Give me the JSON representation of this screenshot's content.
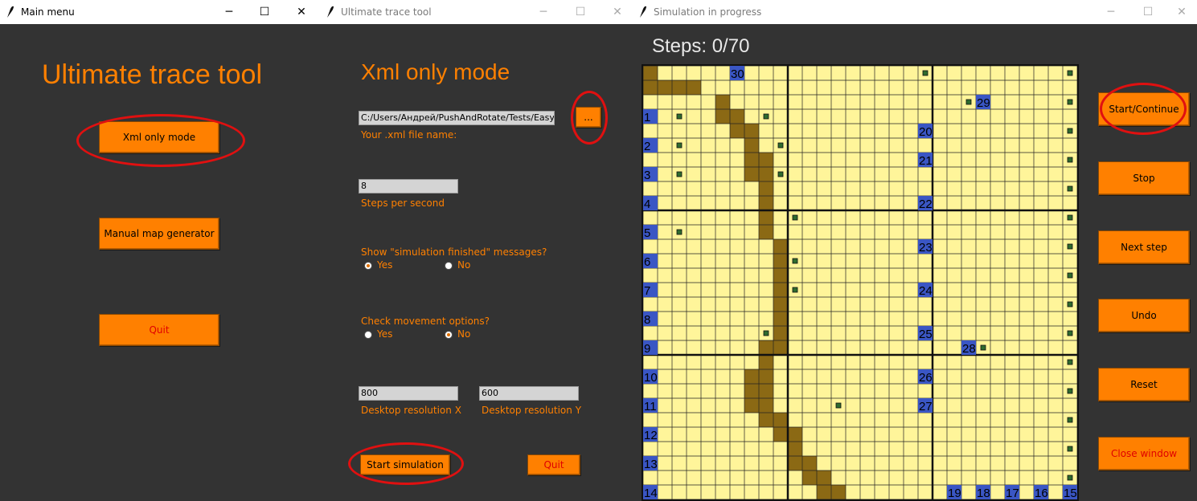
{
  "main_window": {
    "title": "Main menu",
    "heading": "Ultimate trace tool",
    "xml_button": "Xml only mode",
    "manual_button": "Manual map generator",
    "quit_button": "Quit",
    "controls": {
      "minimize": "─",
      "maximize": "☐",
      "close": "✕"
    }
  },
  "tool_window": {
    "title": "Ultimate trace tool",
    "heading": "Xml only mode",
    "file_path": "C:/Users/Андрей/PushAndRotate/Tests/EasyE",
    "browse_button": "...",
    "file_label": "Your .xml file name:",
    "steps_value": "8",
    "steps_label": "Steps per second",
    "show_msg_question": "Show \"simulation finished\" messages?",
    "show_msg_yes": "Yes",
    "show_msg_no": "No",
    "show_msg_selected": "Yes",
    "check_move_question": "Check movement options?",
    "check_move_yes": "Yes",
    "check_move_no": "No",
    "check_move_selected": "No",
    "res_x_value": "800",
    "res_x_label": "Desktop resolution X",
    "res_y_value": "600",
    "res_y_label": "Desktop resolution Y",
    "start_button": "Start simulation",
    "quit_button": "Quit",
    "controls": {
      "minimize": "─",
      "maximize": "☐",
      "close": "✕"
    }
  },
  "sim_window": {
    "title": "Simulation in progress",
    "steps_text": "Steps: 0/70",
    "buttons": {
      "start": "Start/Continue",
      "stop": "Stop",
      "next": "Next step",
      "undo": "Undo",
      "reset": "Reset",
      "close": "Close window"
    },
    "controls": {
      "minimize": "─",
      "maximize": "☐",
      "close": "✕"
    }
  },
  "colors": {
    "accent": "#ff8000",
    "background": "#333333",
    "cell": "#fff59a",
    "obstacle": "#8b6914",
    "agent": "#3a56c4",
    "goal": "#2e6b2e",
    "highlight_oval": "#e01010"
  },
  "grid_map": {
    "rows": 30,
    "cols": 30,
    "obstacles": [
      [
        0,
        0
      ],
      [
        1,
        0
      ],
      [
        1,
        1
      ],
      [
        1,
        2
      ],
      [
        1,
        3
      ],
      [
        2,
        5
      ],
      [
        3,
        5
      ],
      [
        3,
        6
      ],
      [
        4,
        6
      ],
      [
        4,
        7
      ],
      [
        5,
        7
      ],
      [
        6,
        7
      ],
      [
        6,
        8
      ],
      [
        7,
        7
      ],
      [
        7,
        8
      ],
      [
        8,
        8
      ],
      [
        9,
        8
      ],
      [
        10,
        8
      ],
      [
        11,
        8
      ],
      [
        12,
        9
      ],
      [
        13,
        9
      ],
      [
        14,
        9
      ],
      [
        15,
        9
      ],
      [
        16,
        9
      ],
      [
        17,
        9
      ],
      [
        18,
        9
      ],
      [
        19,
        8
      ],
      [
        19,
        9
      ],
      [
        20,
        8
      ],
      [
        21,
        7
      ],
      [
        21,
        8
      ],
      [
        22,
        7
      ],
      [
        22,
        8
      ],
      [
        23,
        7
      ],
      [
        23,
        8
      ],
      [
        24,
        8
      ],
      [
        24,
        9
      ],
      [
        25,
        9
      ],
      [
        25,
        10
      ],
      [
        26,
        10
      ],
      [
        27,
        10
      ],
      [
        27,
        11
      ],
      [
        28,
        11
      ],
      [
        28,
        12
      ],
      [
        29,
        12
      ],
      [
        29,
        13
      ],
      [
        30,
        13
      ],
      [
        30,
        14
      ],
      [
        31,
        14
      ],
      [
        31,
        15
      ],
      [
        32,
        15
      ],
      [
        33,
        15
      ],
      [
        33,
        16
      ]
    ],
    "agents": [
      {
        "label": "30",
        "row": 0,
        "col": 6
      },
      {
        "label": "29",
        "row": 2,
        "col": 23
      },
      {
        "label": "1",
        "row": 3,
        "col": 0
      },
      {
        "label": "20",
        "row": 4,
        "col": 19
      },
      {
        "label": "2",
        "row": 5,
        "col": 0
      },
      {
        "label": "21",
        "row": 6,
        "col": 19
      },
      {
        "label": "3",
        "row": 7,
        "col": 0
      },
      {
        "label": "4",
        "row": 9,
        "col": 0
      },
      {
        "label": "22",
        "row": 9,
        "col": 19
      },
      {
        "label": "5",
        "row": 11,
        "col": 0
      },
      {
        "label": "23",
        "row": 12,
        "col": 19
      },
      {
        "label": "6",
        "row": 13,
        "col": 0
      },
      {
        "label": "7",
        "row": 15,
        "col": 0
      },
      {
        "label": "24",
        "row": 15,
        "col": 19
      },
      {
        "label": "8",
        "row": 17,
        "col": 0
      },
      {
        "label": "25",
        "row": 18,
        "col": 19
      },
      {
        "label": "9",
        "row": 19,
        "col": 0
      },
      {
        "label": "28",
        "row": 19,
        "col": 22
      },
      {
        "label": "10",
        "row": 21,
        "col": 0
      },
      {
        "label": "26",
        "row": 21,
        "col": 19
      },
      {
        "label": "11",
        "row": 23,
        "col": 0
      },
      {
        "label": "27",
        "row": 23,
        "col": 19
      },
      {
        "label": "12",
        "row": 25,
        "col": 0
      },
      {
        "label": "13",
        "row": 27,
        "col": 0
      },
      {
        "label": "14",
        "row": 29,
        "col": 0
      },
      {
        "label": "19",
        "row": 29,
        "col": 21
      },
      {
        "label": "18",
        "row": 29,
        "col": 23
      },
      {
        "label": "17",
        "row": 29,
        "col": 25
      },
      {
        "label": "16",
        "row": 29,
        "col": 27
      },
      {
        "label": "15",
        "row": 29,
        "col": 29
      }
    ],
    "goals": [
      [
        0,
        19
      ],
      [
        0,
        29
      ],
      [
        2,
        22
      ],
      [
        2,
        29
      ],
      [
        3,
        2
      ],
      [
        3,
        8
      ],
      [
        4,
        29
      ],
      [
        5,
        2
      ],
      [
        5,
        9
      ],
      [
        6,
        29
      ],
      [
        7,
        2
      ],
      [
        7,
        9
      ],
      [
        8,
        29
      ],
      [
        10,
        10
      ],
      [
        10,
        29
      ],
      [
        11,
        2
      ],
      [
        12,
        29
      ],
      [
        13,
        10
      ],
      [
        14,
        29
      ],
      [
        15,
        10
      ],
      [
        16,
        29
      ],
      [
        18,
        8
      ],
      [
        18,
        29
      ],
      [
        19,
        23
      ],
      [
        20,
        29
      ],
      [
        22,
        29
      ],
      [
        23,
        13
      ],
      [
        24,
        29
      ],
      [
        26,
        29
      ],
      [
        28,
        29
      ]
    ],
    "thick_rows": [
      10,
      20
    ],
    "thick_cols": [
      10,
      20
    ]
  }
}
